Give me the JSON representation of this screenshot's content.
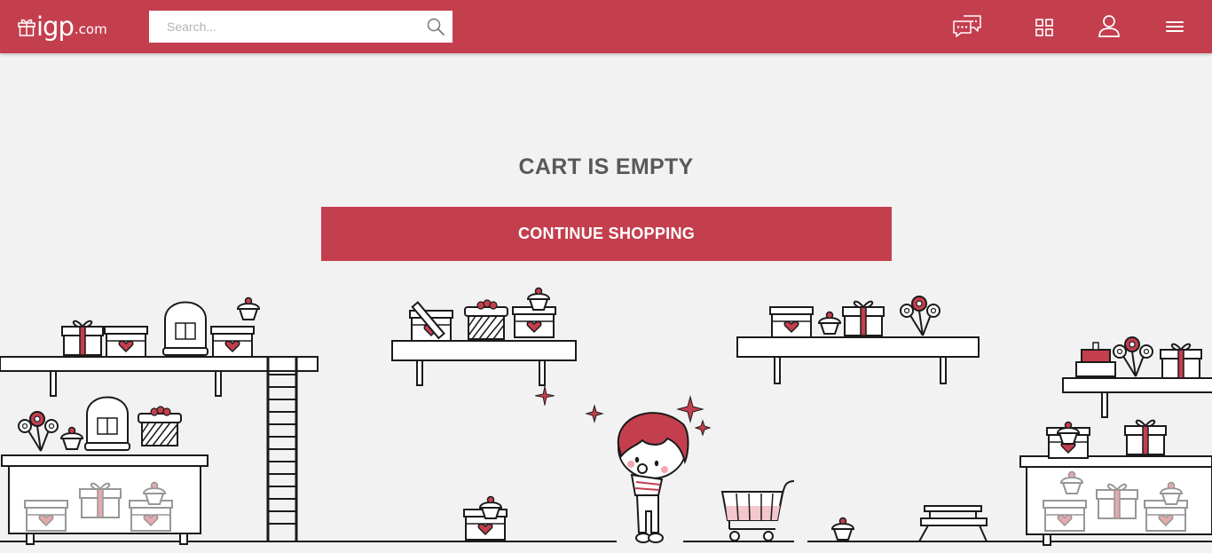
{
  "header": {
    "logo_text": "igp",
    "logo_domain": ".com",
    "search_placeholder": "Search...",
    "icons": [
      "gift-icon",
      "search-icon",
      "chat-icon",
      "grid-icon",
      "user-icon",
      "menu-icon"
    ]
  },
  "main": {
    "title": "CART IS EMPTY",
    "button_label": "CONTINUE SHOPPING"
  },
  "colors": {
    "brand": "#c43f4e",
    "background": "#f2f2f2",
    "title_text": "#595959",
    "line_art": "#1a1a1a"
  }
}
